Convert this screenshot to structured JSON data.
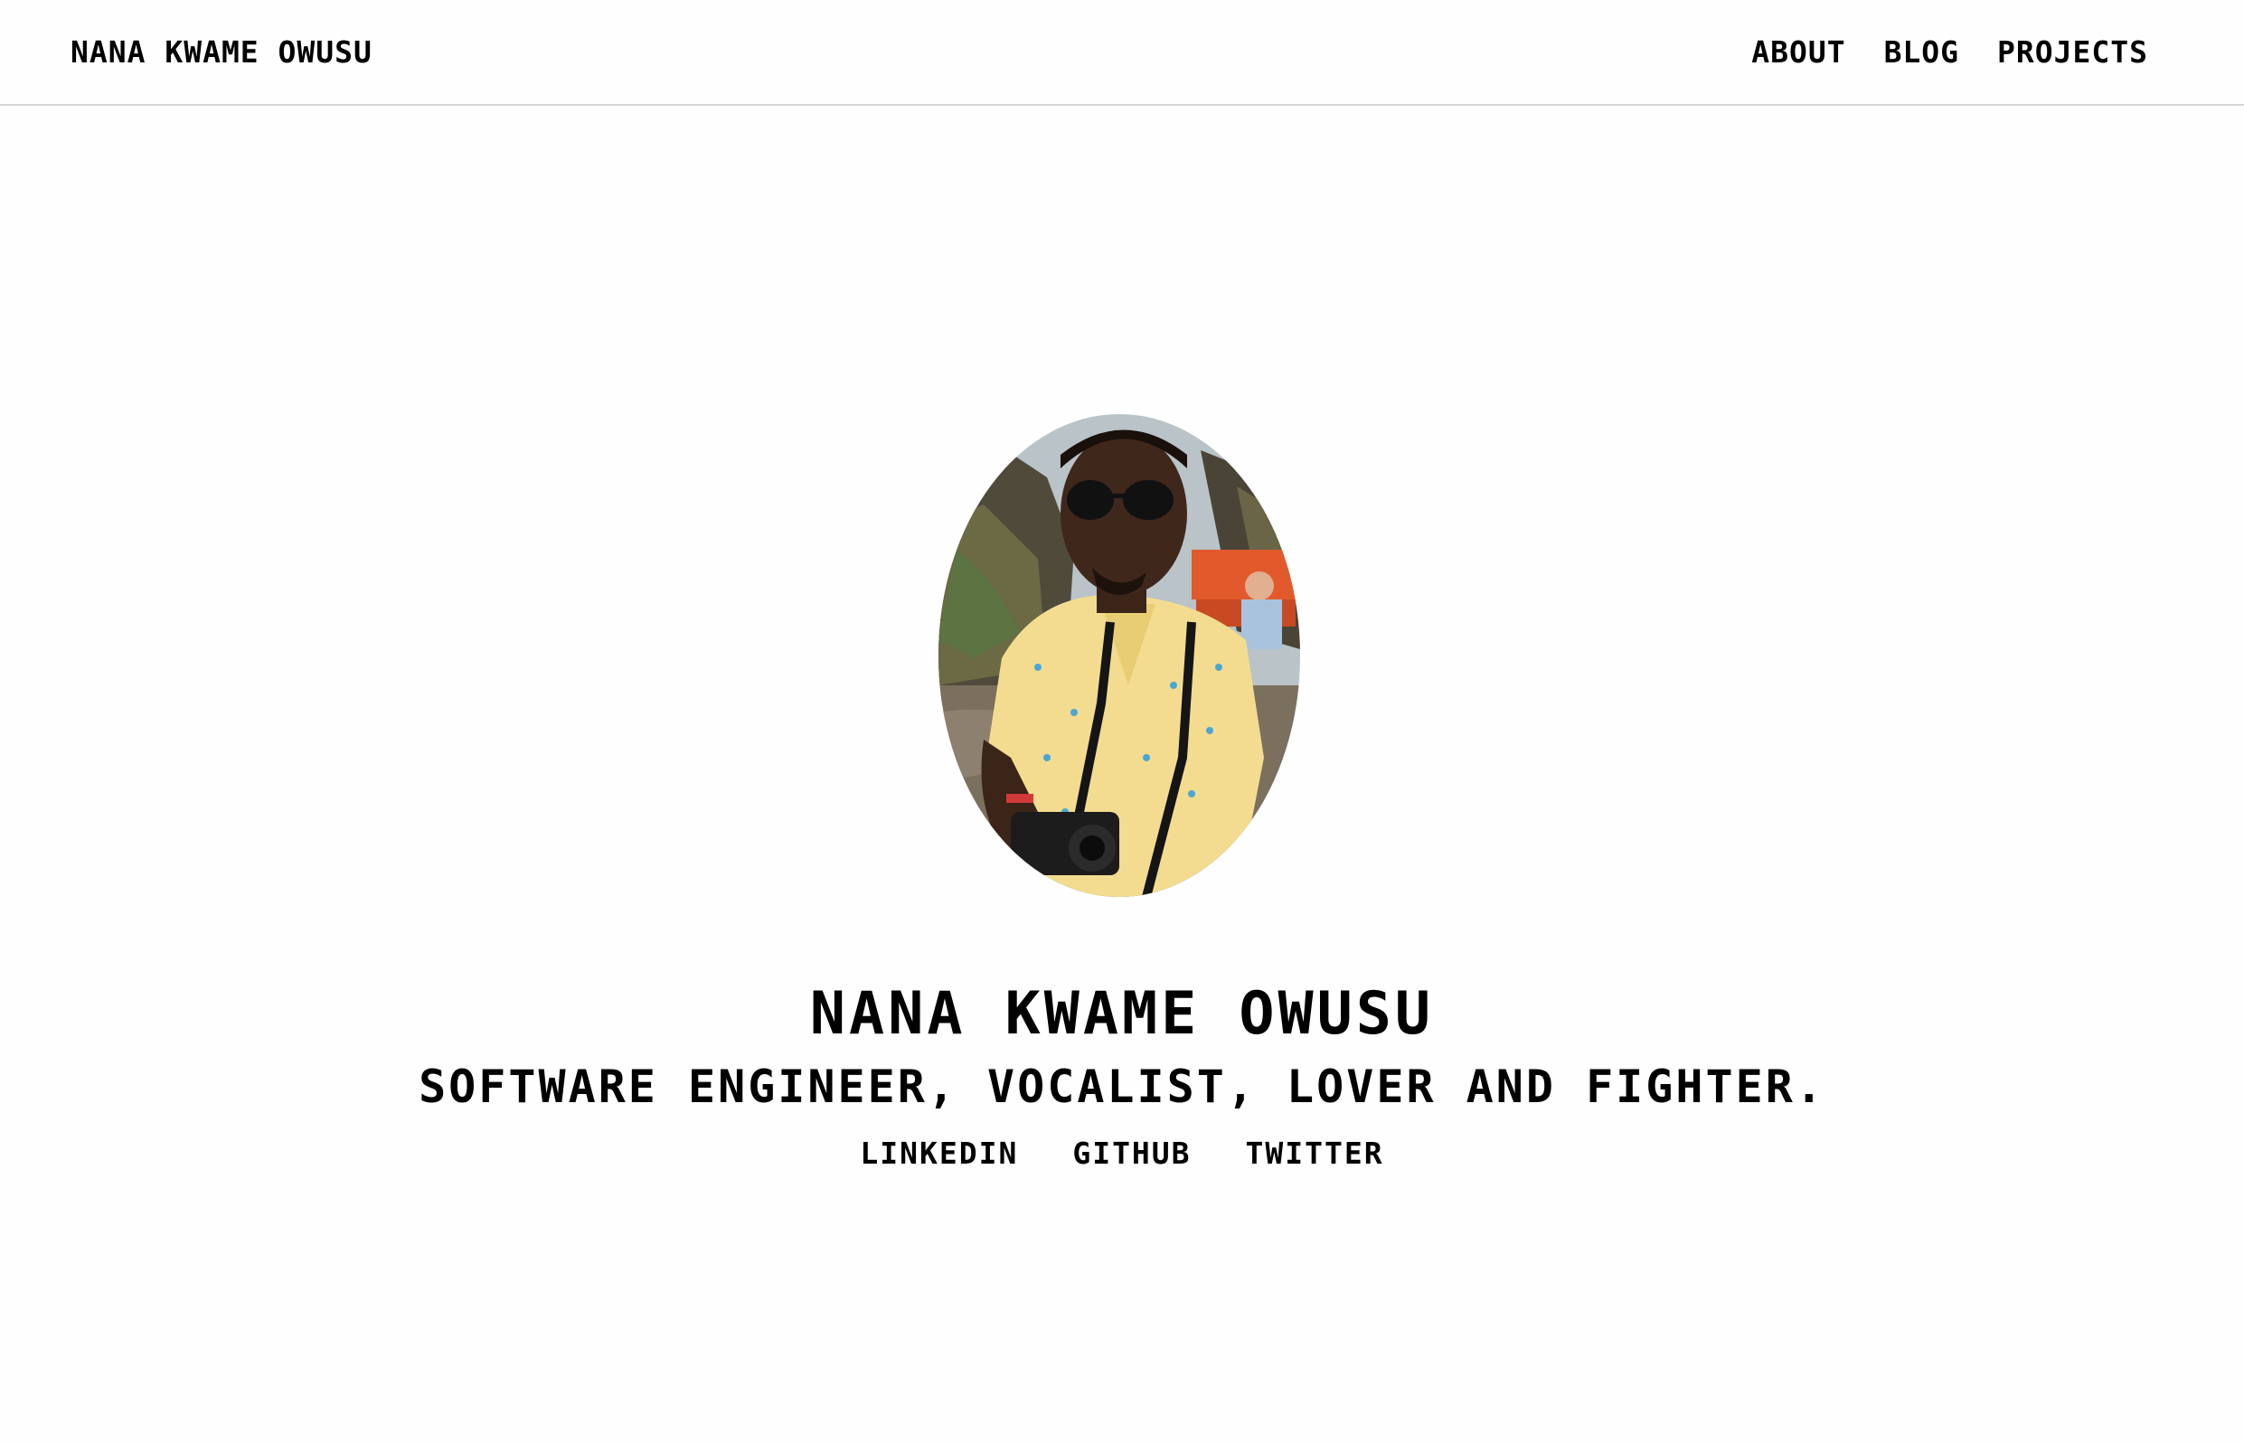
{
  "header": {
    "brand": "NANA KWAME OWUSU",
    "nav": [
      {
        "label": "ABOUT"
      },
      {
        "label": "BLOG"
      },
      {
        "label": "PROJECTS"
      }
    ]
  },
  "hero": {
    "portrait_icon": "profile-photo",
    "name": "NANA KWAME OWUSU",
    "tagline": "SOFTWARE ENGINEER, VOCALIST, LOVER AND FIGHTER."
  },
  "social": [
    {
      "label": "LINKEDIN"
    },
    {
      "label": "GITHUB"
    },
    {
      "label": "TWITTER"
    }
  ],
  "colors": {
    "text": "#000000",
    "background": "#fefefe",
    "divider": "#d4d4d4"
  }
}
